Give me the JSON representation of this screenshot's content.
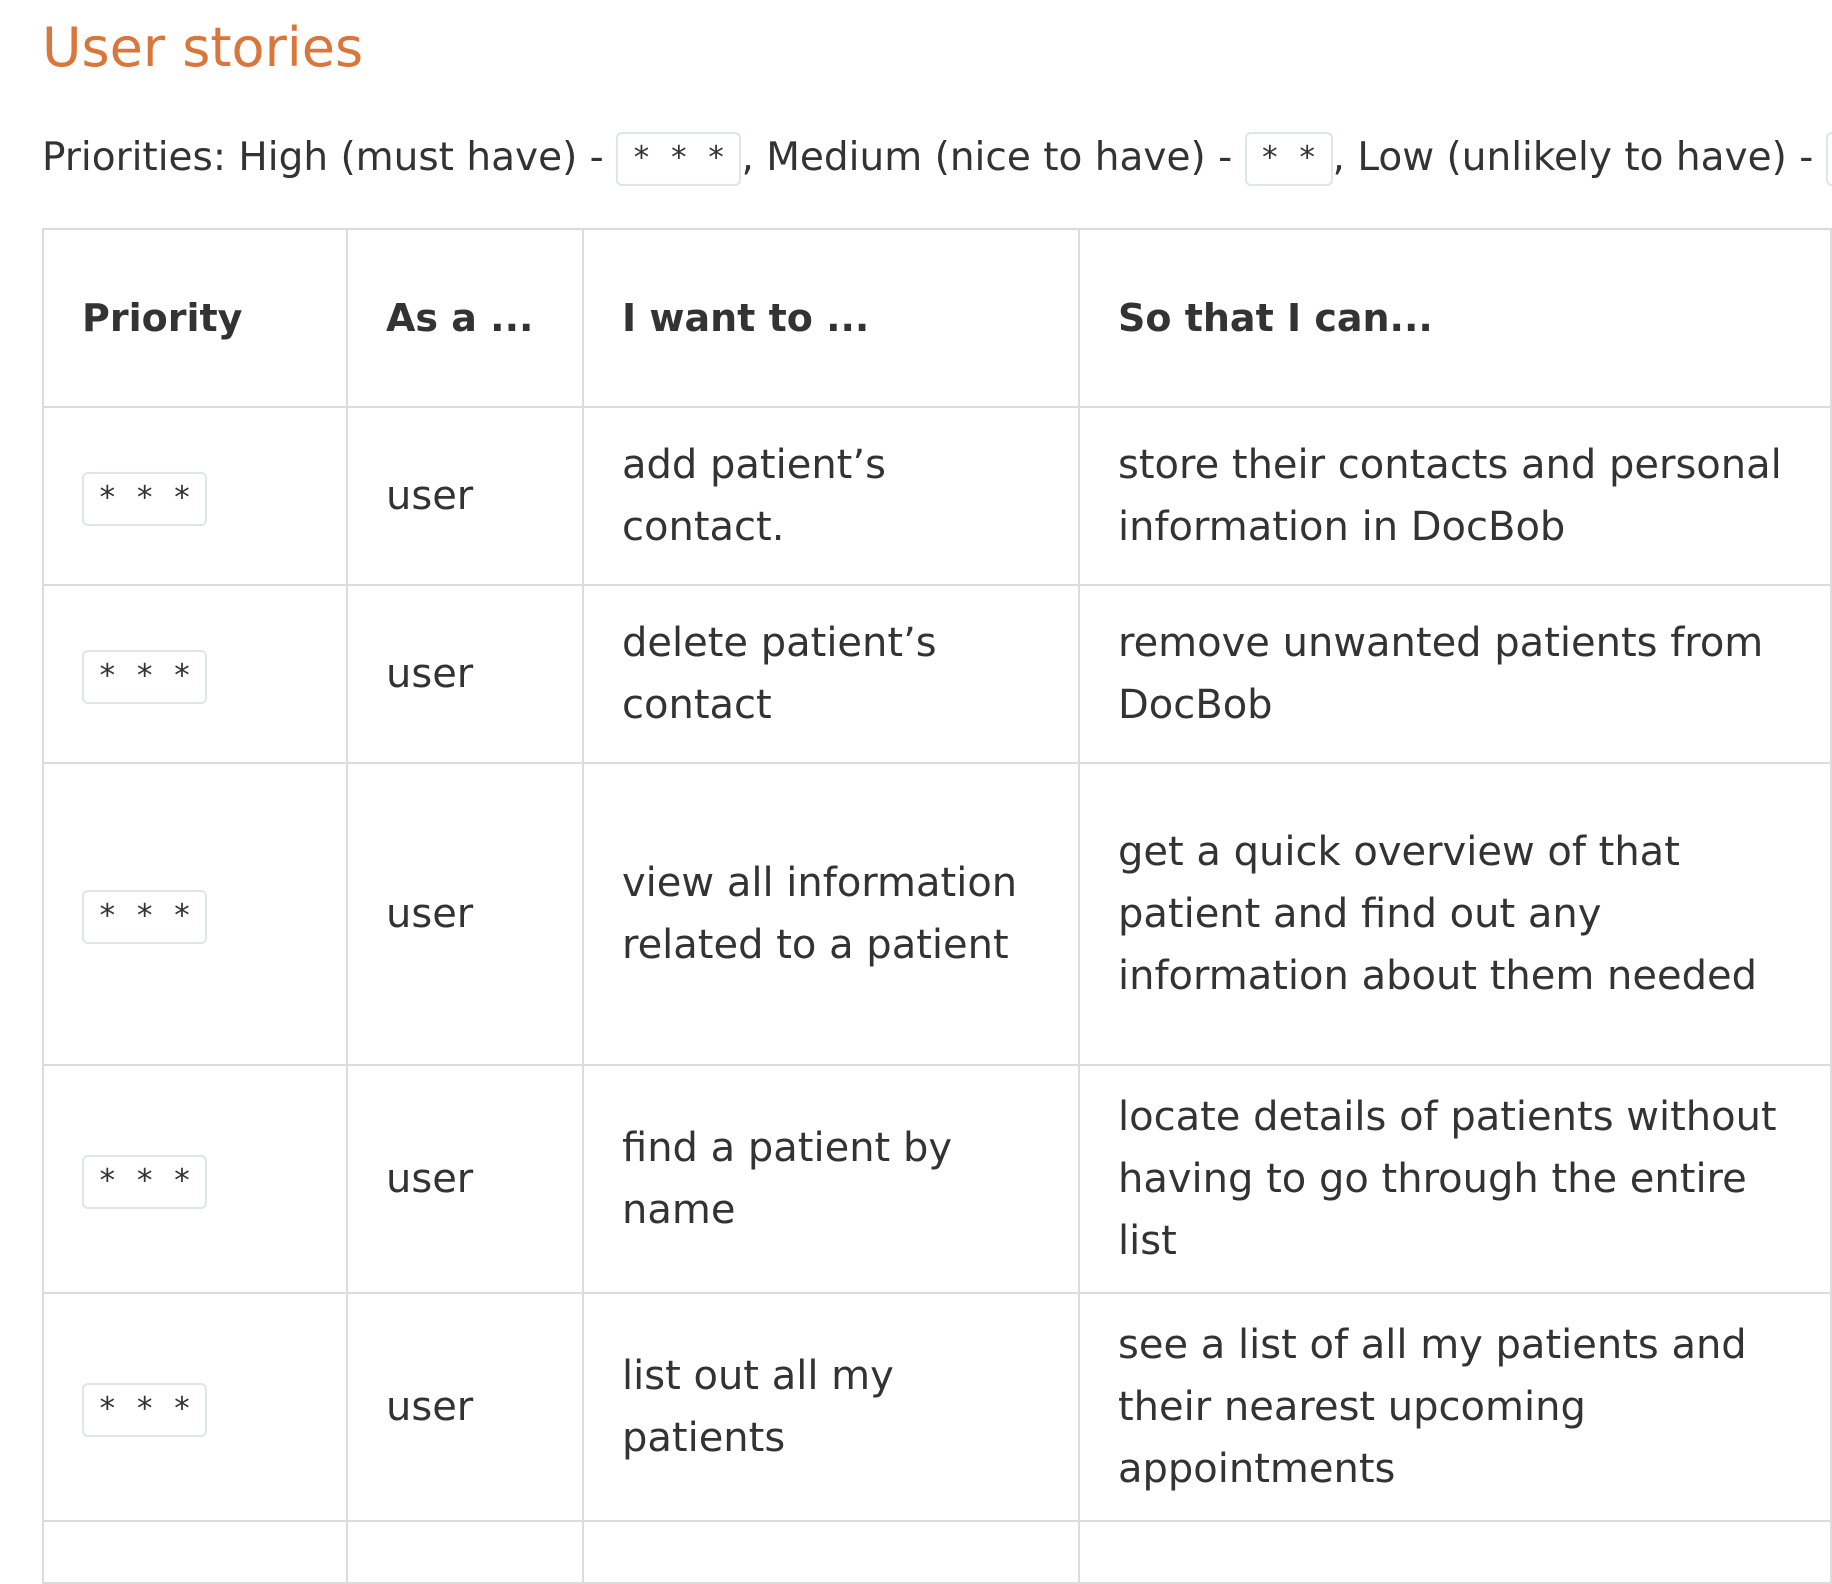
{
  "title": "User stories",
  "priorities_line": {
    "prefix": "Priorities: High (must have) - ",
    "high_code": "* * *",
    "sep1": ", Medium (nice to have) - ",
    "medium_code": "* *",
    "sep2": ", Low (unlikely to have) - ",
    "low_code": "*"
  },
  "table": {
    "headers": {
      "priority": "Priority",
      "as_a": "As a ...",
      "want": "I want to ...",
      "so_that": "So that I can..."
    },
    "rows": [
      {
        "priority": "* * *",
        "as_a": "user",
        "want": "add patient’s contact.",
        "so_that": "store their contacts and personal information in DocBob"
      },
      {
        "priority": "* * *",
        "as_a": "user",
        "want": "delete patient’s contact",
        "so_that": "remove unwanted patients from DocBob"
      },
      {
        "priority": "* * *",
        "as_a": "user",
        "want": "view all information related to a patient",
        "so_that": "get a quick overview of that patient and find out any information about them needed"
      },
      {
        "priority": "* * *",
        "as_a": "user",
        "want": "find a patient by name",
        "so_that": "locate details of patients without having to go through the entire list"
      },
      {
        "priority": "* * *",
        "as_a": "user",
        "want": "list out all my patients",
        "so_that": "see a list of all my patients and their nearest upcoming appointments"
      }
    ]
  }
}
